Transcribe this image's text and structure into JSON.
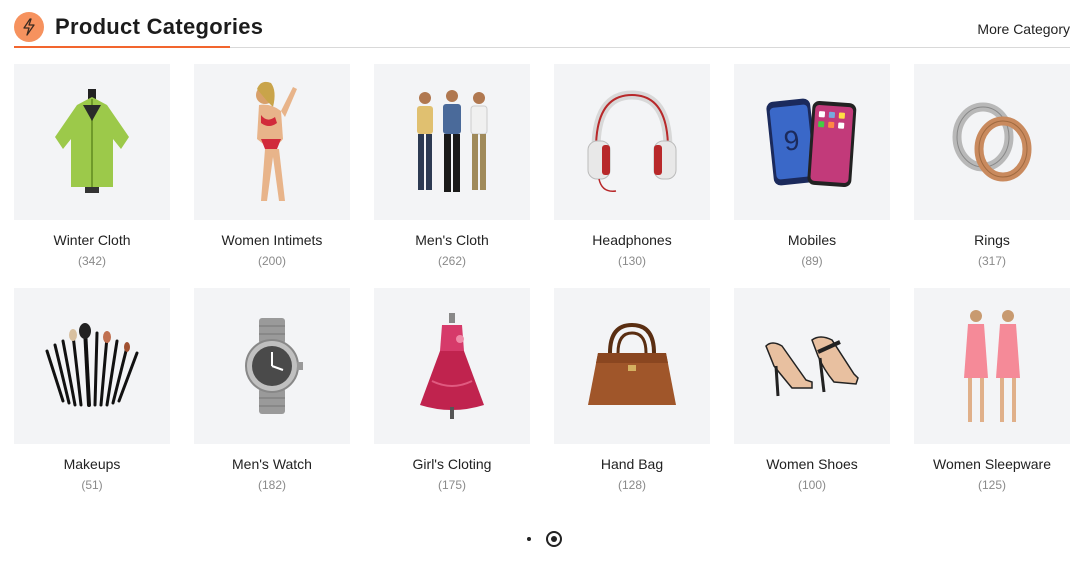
{
  "header": {
    "title": "Product Categories",
    "more_label": "More Category",
    "accent_color": "#f2652e",
    "icon": "lightning-bolt-icon"
  },
  "categories": [
    {
      "name": "Winter Cloth",
      "count": "(342)",
      "icon": "green-coat-image"
    },
    {
      "name": "Women Intimets",
      "count": "(200)",
      "icon": "bikini-model-image"
    },
    {
      "name": "Men's Cloth",
      "count": "(262)",
      "icon": "three-men-image"
    },
    {
      "name": "Headphones",
      "count": "(130)",
      "icon": "headphones-image"
    },
    {
      "name": "Mobiles",
      "count": "(89)",
      "icon": "smartphones-image"
    },
    {
      "name": "Rings",
      "count": "(317)",
      "icon": "rings-image"
    },
    {
      "name": "Makeups",
      "count": "(51)",
      "icon": "makeup-brushes-image"
    },
    {
      "name": "Men's Watch",
      "count": "(182)",
      "icon": "wristwatch-image"
    },
    {
      "name": "Girl's Cloting",
      "count": "(175)",
      "icon": "girls-dress-image"
    },
    {
      "name": "Hand Bag",
      "count": "(128)",
      "icon": "handbag-image"
    },
    {
      "name": "Women Shoes",
      "count": "(100)",
      "icon": "high-heels-image"
    },
    {
      "name": "Women Sleepware",
      "count": "(125)",
      "icon": "sleepwear-dress-image"
    }
  ],
  "pagination": {
    "pages": 2,
    "active_page": 2
  }
}
